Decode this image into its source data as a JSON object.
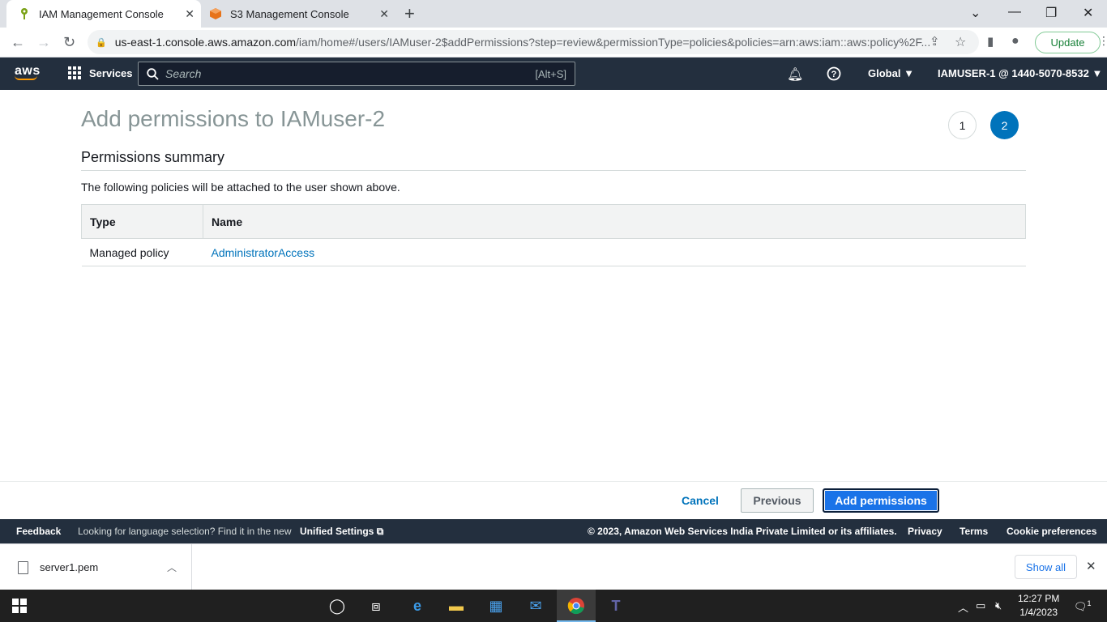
{
  "browser": {
    "tabs": [
      {
        "title": "IAM Management Console",
        "active": true
      },
      {
        "title": "S3 Management Console",
        "active": false
      }
    ],
    "url_host": "us-east-1.console.aws.amazon.com",
    "url_path": "/iam/home#/users/IAMuser-2$addPermissions?step=review&permissionType=policies&policies=arn:aws:iam::aws:policy%2F...",
    "update_label": "Update"
  },
  "aws_header": {
    "logo": "aws",
    "services_label": "Services",
    "search_placeholder": "Search",
    "search_shortcut": "[Alt+S]",
    "region": "Global",
    "account": "IAMUSER-1 @ 1440-5070-8532"
  },
  "page": {
    "title": "Add permissions to IAMuser-2",
    "steps": [
      "1",
      "2"
    ],
    "current_step": 2,
    "section_title": "Permissions summary",
    "description": "The following policies will be attached to the user shown above.",
    "table": {
      "headers": [
        "Type",
        "Name"
      ],
      "rows": [
        {
          "type": "Managed policy",
          "name": "AdministratorAccess"
        }
      ]
    }
  },
  "actions": {
    "cancel": "Cancel",
    "previous": "Previous",
    "add": "Add permissions"
  },
  "aws_footer": {
    "feedback": "Feedback",
    "language_note": "Looking for language selection? Find it in the new",
    "unified_settings": "Unified Settings",
    "copyright": "© 2023, Amazon Web Services India Private Limited or its affiliates.",
    "privacy": "Privacy",
    "terms": "Terms",
    "cookies": "Cookie preferences"
  },
  "downloads": {
    "file": "server1.pem",
    "show_all": "Show all"
  },
  "taskbar": {
    "time": "12:27 PM",
    "date": "1/4/2023",
    "notification_count": "1"
  }
}
